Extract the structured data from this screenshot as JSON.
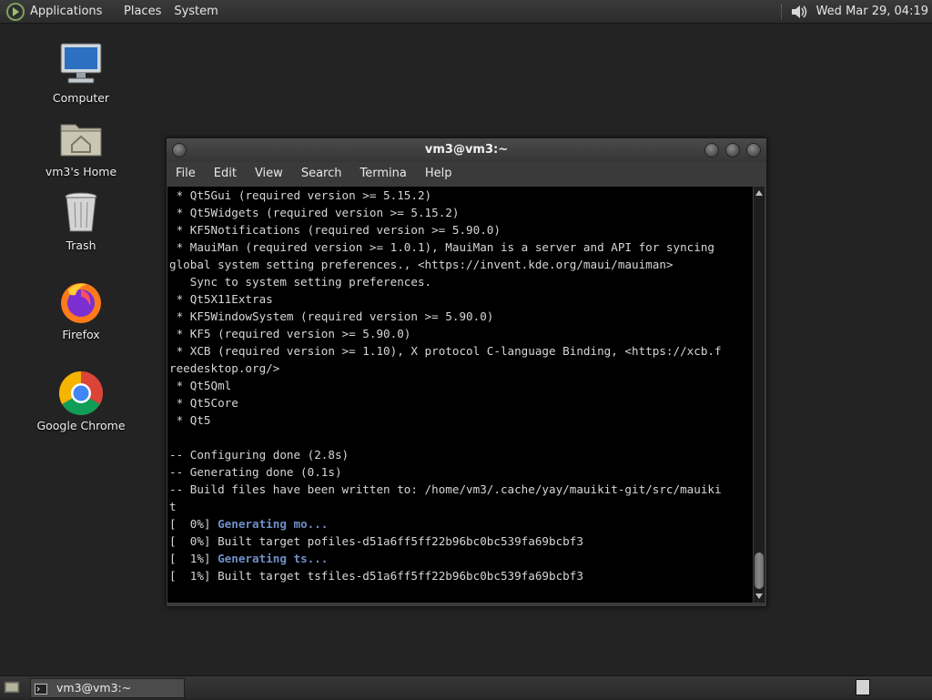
{
  "top_panel": {
    "applications": "Applications",
    "places": "Places",
    "system": "System",
    "clock": "Wed Mar 29, 04:19"
  },
  "desktop": {
    "icons": [
      {
        "label": "Computer",
        "icon": "computer-icon"
      },
      {
        "label": "vm3's Home",
        "icon": "home-folder-icon"
      },
      {
        "label": "Trash",
        "icon": "trash-icon"
      },
      {
        "label": "Firefox",
        "icon": "firefox-icon"
      },
      {
        "label": "Google Chrome",
        "icon": "chrome-icon"
      }
    ]
  },
  "window": {
    "title": "vm3@vm3:~",
    "menu": [
      "File",
      "Edit",
      "View",
      "Search",
      "Termina",
      "Help"
    ]
  },
  "terminal": {
    "lines": [
      {
        "segments": [
          {
            "text": " * Qt5Gui (required version >= 5.15.2)"
          }
        ]
      },
      {
        "segments": [
          {
            "text": " * Qt5Widgets (required version >= 5.15.2)"
          }
        ]
      },
      {
        "segments": [
          {
            "text": " * KF5Notifications (required version >= 5.90.0)"
          }
        ]
      },
      {
        "segments": [
          {
            "text": " * MauiMan (required version >= 1.0.1), MauiMan is a server and API for syncing"
          }
        ]
      },
      {
        "segments": [
          {
            "text": "global system setting preferences., <https://invent.kde.org/maui/mauiman>"
          }
        ]
      },
      {
        "segments": [
          {
            "text": "   Sync to system setting preferences."
          }
        ]
      },
      {
        "segments": [
          {
            "text": " * Qt5X11Extras"
          }
        ]
      },
      {
        "segments": [
          {
            "text": " * KF5WindowSystem (required version >= 5.90.0)"
          }
        ]
      },
      {
        "segments": [
          {
            "text": " * KF5 (required version >= 5.90.0)"
          }
        ]
      },
      {
        "segments": [
          {
            "text": " * XCB (required version >= 1.10), X protocol C-language Binding, <https://xcb.f"
          }
        ]
      },
      {
        "segments": [
          {
            "text": "reedesktop.org/>"
          }
        ]
      },
      {
        "segments": [
          {
            "text": " * Qt5Qml"
          }
        ]
      },
      {
        "segments": [
          {
            "text": " * Qt5Core"
          }
        ]
      },
      {
        "segments": [
          {
            "text": " * Qt5"
          }
        ]
      },
      {
        "segments": [
          {
            "text": ""
          }
        ]
      },
      {
        "segments": [
          {
            "text": "-- Configuring done (2.8s)"
          }
        ]
      },
      {
        "segments": [
          {
            "text": "-- Generating done (0.1s)"
          }
        ]
      },
      {
        "segments": [
          {
            "text": "-- Build files have been written to: /home/vm3/.cache/yay/mauikit-git/src/mauiki"
          }
        ]
      },
      {
        "segments": [
          {
            "text": "t"
          }
        ]
      },
      {
        "segments": [
          {
            "text": "[  0%] "
          },
          {
            "text": "Generating mo...",
            "hl": true
          }
        ]
      },
      {
        "segments": [
          {
            "text": "[  0%] Built target pofiles-d51a6ff5ff22b96bc0bc539fa69bcbf3"
          }
        ]
      },
      {
        "segments": [
          {
            "text": "[  1%] "
          },
          {
            "text": "Generating ts...",
            "hl": true
          }
        ]
      },
      {
        "segments": [
          {
            "text": "[  1%] Built target tsfiles-d51a6ff5ff22b96bc0bc539fa69bcbf3"
          }
        ]
      }
    ]
  },
  "taskbar": {
    "task_label": "vm3@vm3:~"
  }
}
